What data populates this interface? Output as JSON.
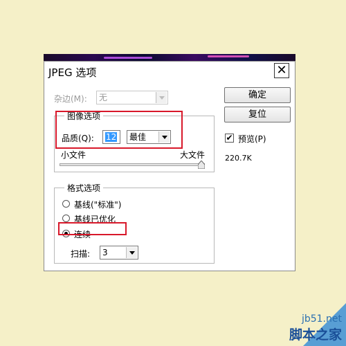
{
  "dialog": {
    "title": "JPEG 选项",
    "close_glyph": "✕",
    "matte_label": "杂边(M):",
    "matte_value": "无",
    "ok_button": "确定",
    "reset_button": "复位",
    "preview_label": "预览(P)",
    "preview_checked": true,
    "file_size": "220.7K",
    "image_options": {
      "title": "图像选项",
      "quality_label": "品质(Q):",
      "quality_value": "12",
      "quality_preset": "最佳",
      "small_file_label": "小文件",
      "large_file_label": "大文件",
      "slider_level": 1.0
    },
    "format_options": {
      "title": "格式选项",
      "options": [
        "基线(\"标准\")",
        "基线已优化",
        "连续"
      ],
      "selected": "连续",
      "scans_label": "扫描:",
      "scans_value": "3"
    }
  },
  "highlight_color": "#d8182a",
  "watermark": {
    "url": "jb51.net",
    "name": "脚本之家"
  }
}
